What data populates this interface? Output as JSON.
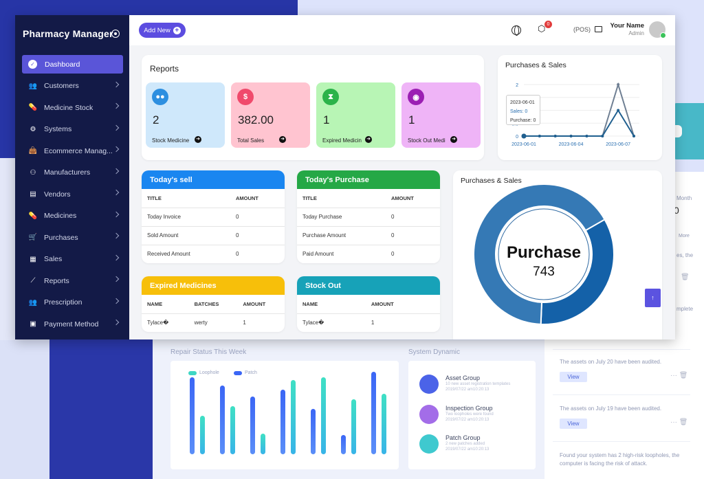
{
  "sidebar": {
    "brand": "Pharmacy Manager",
    "items": [
      {
        "label": "Dashboard",
        "icon": "dashboard-icon",
        "active": true
      },
      {
        "label": "Customers",
        "icon": "users-icon"
      },
      {
        "label": "Medicine Stock",
        "icon": "pills-icon"
      },
      {
        "label": "Systems",
        "icon": "cogs-icon"
      },
      {
        "label": "Ecommerce Manag...",
        "icon": "shopping-bag-icon"
      },
      {
        "label": "Manufacturers",
        "icon": "people-carry-icon"
      },
      {
        "label": "Vendors",
        "icon": "store-icon"
      },
      {
        "label": "Medicines",
        "icon": "pills-icon"
      },
      {
        "label": "Purchases",
        "icon": "cart-icon"
      },
      {
        "label": "Sales",
        "icon": "receipt-icon"
      },
      {
        "label": "Reports",
        "icon": "chart-line-icon"
      },
      {
        "label": "Prescription",
        "icon": "users-icon"
      },
      {
        "label": "Payment Method",
        "icon": "money-icon"
      }
    ]
  },
  "topbar": {
    "add_new": "Add New",
    "notification_count": "0",
    "pos": "(POS)",
    "user_name": "Your Name",
    "user_role": "Admin"
  },
  "reports": {
    "title": "Reports",
    "stats": [
      {
        "value": "2",
        "label": "Stock Medicine",
        "color": "#cfe8fb",
        "icon_bg": "#2d8fe0",
        "icon": "pills-icon"
      },
      {
        "value": "382.00",
        "label": "Total Sales",
        "color": "#ffc4d0",
        "icon_bg": "#f04a6c",
        "icon": "dollar-icon"
      },
      {
        "value": "1",
        "label": "Expired Medicin",
        "color": "#b8f5b5",
        "icon_bg": "#2bb34a",
        "icon": "hourglass-icon"
      },
      {
        "value": "1",
        "label": "Stock Out Medi",
        "color": "#efb4f7",
        "icon_bg": "#9b1fb3",
        "icon": "message-icon"
      }
    ]
  },
  "purchases_sales_line": {
    "title": "Purchases & Sales",
    "tooltip": {
      "date": "2023-06-01",
      "sales": "Sales: 0",
      "purchase": "Purchase: 0"
    }
  },
  "todays_sell": {
    "title": "Today's sell",
    "columns": [
      "TITLE",
      "AMOUNT"
    ],
    "rows": [
      [
        "Today Invoice",
        "0"
      ],
      [
        "Sold Amount",
        "0"
      ],
      [
        "Received Amount",
        "0"
      ]
    ]
  },
  "todays_purchase": {
    "title": "Today's Purchase",
    "columns": [
      "TITLE",
      "AMOUNT"
    ],
    "rows": [
      [
        "Today Purchase",
        "0"
      ],
      [
        "Purchase Amount",
        "0"
      ],
      [
        "Paid Amount",
        "0"
      ]
    ]
  },
  "expired_medicines": {
    "title": "Expired Medicines",
    "columns": [
      "NAME",
      "BATCHES",
      "AMOUNT"
    ],
    "rows": [
      [
        "Tylace�",
        "werty",
        "1"
      ]
    ]
  },
  "stock_out": {
    "title": "Stock Out",
    "columns": [
      "NAME",
      "AMOUNT"
    ],
    "rows": [
      [
        "Tylace�",
        "1"
      ]
    ]
  },
  "purchases_sales_donut": {
    "title": "Purchases & Sales",
    "center_label": "Purchase",
    "center_value": "743"
  },
  "chart_data": [
    {
      "type": "line",
      "title": "Purchases & Sales",
      "x": [
        "2023-06-01",
        "2023-06-02",
        "2023-06-03",
        "2023-06-04",
        "2023-06-05",
        "2023-06-06",
        "2023-06-07",
        "2023-06-08"
      ],
      "xticks": [
        "2023-06-01",
        "2023-06-04",
        "2023-06-07"
      ],
      "yticks": [
        "0",
        "0.5",
        "1",
        "1.5",
        "2"
      ],
      "ylim": [
        0,
        2
      ],
      "series": [
        {
          "name": "Sales",
          "values": [
            0,
            0,
            0,
            0,
            0,
            0,
            1,
            0
          ],
          "color": "#1f5f8f"
        },
        {
          "name": "Purchase",
          "values": [
            0,
            0,
            0,
            0,
            0,
            0,
            2,
            0
          ],
          "color": "#6f7f93"
        }
      ]
    },
    {
      "type": "pie",
      "title": "Purchases & Sales",
      "labels": [
        "Purchase",
        "Sales"
      ],
      "values": [
        743,
        382
      ],
      "colors": [
        "#3579b5",
        "#1461a8"
      ]
    }
  ],
  "background": {
    "repair_title": "Repair Status This Week",
    "legend_a": "Loophole",
    "legend_b": "Patch",
    "system_dynamic_title": "System Dynamic",
    "dynamics": [
      {
        "title": "Asset Group",
        "sub": "10 new asset registration templates",
        "date": "2019/07/22 am10:20:13"
      },
      {
        "title": "Inspection Group",
        "sub": "Two loopholes were found",
        "date": "2019/07/22 am10:20:13"
      },
      {
        "title": "Patch Group",
        "sub": "2 new patches added",
        "date": "2019/07/22 am10:20:13"
      }
    ],
    "right_month": "Month",
    "right_zero": "0",
    "right_more": "More",
    "right_frag1": "es, the",
    "right_frag2": "mplete",
    "audit1": "The assets on July 20 have been audited.",
    "audit2": "The assets on July 19 have been audited.",
    "view": "View",
    "risk": "Found your system has 2 high-risk loopholes, the computer is facing the risk of attack."
  }
}
